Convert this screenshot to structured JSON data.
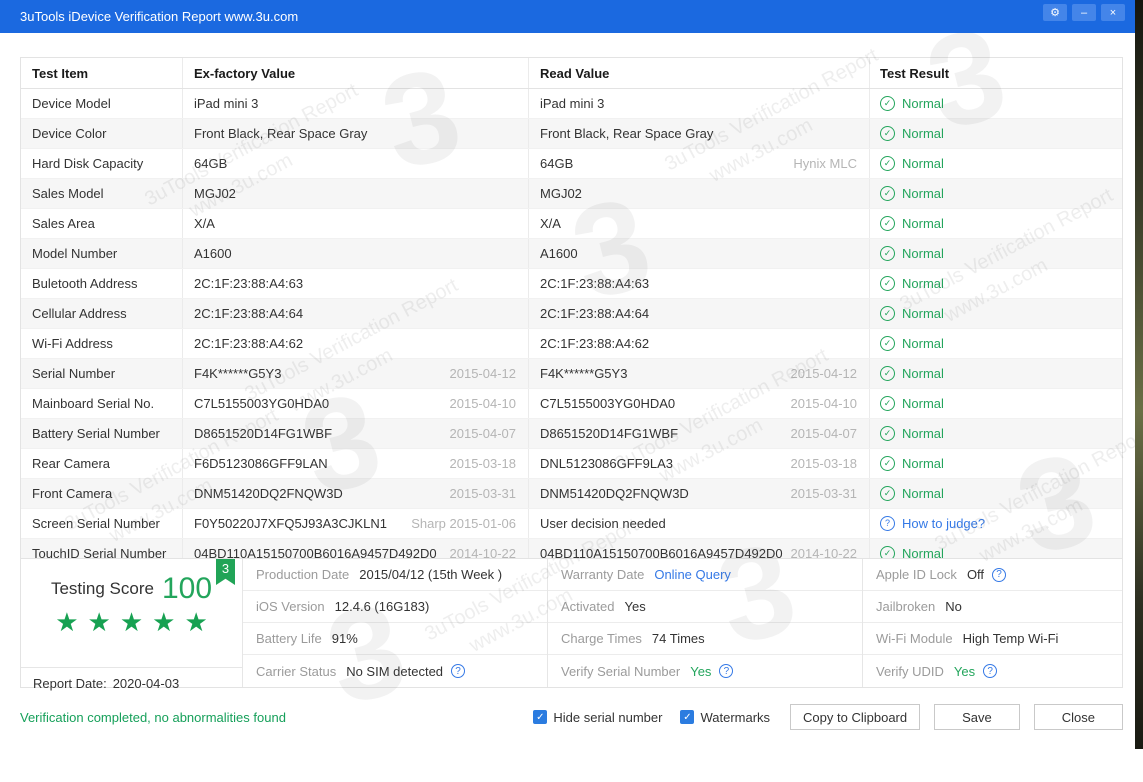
{
  "window": {
    "title": "3uTools iDevice Verification Report www.3u.com",
    "controls": {
      "settings_icon": "⚙",
      "minimize_icon": "–",
      "close_icon": "×"
    }
  },
  "colors": {
    "titlebar_blue": "#1b69e0",
    "accent_green": "#23a55c",
    "link_blue": "#3579e6",
    "checkbox_blue": "#2b7ce0"
  },
  "watermark": {
    "line1": "3uTools Verification Report",
    "line2": "www.3u.com",
    "logo": "3"
  },
  "table": {
    "headers": {
      "item": "Test Item",
      "factory": "Ex-factory Value",
      "read": "Read Value",
      "result": "Test Result"
    },
    "rows": [
      {
        "item": "Device Model",
        "factory": "iPad mini 3",
        "factory_note": "",
        "read": "iPad mini 3",
        "read_note": "",
        "result": "Normal",
        "result_style": "normal",
        "result_icon": "✓",
        "icon_name": "check-circle-icon",
        "result_interactable": "false"
      },
      {
        "item": "Device Color",
        "factory": "Front Black, Rear Space Gray",
        "factory_note": "",
        "read": "Front Black, Rear Space Gray",
        "read_note": "",
        "result": "Normal",
        "result_style": "normal",
        "result_icon": "✓",
        "icon_name": "check-circle-icon",
        "result_interactable": "false"
      },
      {
        "item": "Hard Disk Capacity",
        "factory": "64GB",
        "factory_note": "",
        "read": "64GB",
        "read_note": "Hynix MLC",
        "result": "Normal",
        "result_style": "normal",
        "result_icon": "✓",
        "icon_name": "check-circle-icon",
        "result_interactable": "false"
      },
      {
        "item": "Sales Model",
        "factory": "MGJ02",
        "factory_note": "",
        "read": "MGJ02",
        "read_note": "",
        "result": "Normal",
        "result_style": "normal",
        "result_icon": "✓",
        "icon_name": "check-circle-icon",
        "result_interactable": "false"
      },
      {
        "item": "Sales Area",
        "factory": "X/A",
        "factory_note": "",
        "read": "X/A",
        "read_note": "",
        "result": "Normal",
        "result_style": "normal",
        "result_icon": "✓",
        "icon_name": "check-circle-icon",
        "result_interactable": "false"
      },
      {
        "item": "Model Number",
        "factory": "A1600",
        "factory_note": "",
        "read": "A1600",
        "read_note": "",
        "result": "Normal",
        "result_style": "normal",
        "result_icon": "✓",
        "icon_name": "check-circle-icon",
        "result_interactable": "false"
      },
      {
        "item": "Buletooth Address",
        "factory": "2C:1F:23:88:A4:63",
        "factory_note": "",
        "read": "2C:1F:23:88:A4:63",
        "read_note": "",
        "result": "Normal",
        "result_style": "normal",
        "result_icon": "✓",
        "icon_name": "check-circle-icon",
        "result_interactable": "false"
      },
      {
        "item": "Cellular Address",
        "factory": "2C:1F:23:88:A4:64",
        "factory_note": "",
        "read": "2C:1F:23:88:A4:64",
        "read_note": "",
        "result": "Normal",
        "result_style": "normal",
        "result_icon": "✓",
        "icon_name": "check-circle-icon",
        "result_interactable": "false"
      },
      {
        "item": "Wi-Fi Address",
        "factory": "2C:1F:23:88:A4:62",
        "factory_note": "",
        "read": "2C:1F:23:88:A4:62",
        "read_note": "",
        "result": "Normal",
        "result_style": "normal",
        "result_icon": "✓",
        "icon_name": "check-circle-icon",
        "result_interactable": "false"
      },
      {
        "item": "Serial Number",
        "factory": "F4K******G5Y3",
        "factory_note": "2015-04-12",
        "read": "F4K******G5Y3",
        "read_note": "2015-04-12",
        "result": "Normal",
        "result_style": "normal",
        "result_icon": "✓",
        "icon_name": "check-circle-icon",
        "result_interactable": "false"
      },
      {
        "item": "Mainboard Serial No.",
        "factory": "C7L5155003YG0HDA0",
        "factory_note": "2015-04-10",
        "read": "C7L5155003YG0HDA0",
        "read_note": "2015-04-10",
        "result": "Normal",
        "result_style": "normal",
        "result_icon": "✓",
        "icon_name": "check-circle-icon",
        "result_interactable": "false"
      },
      {
        "item": "Battery Serial Number",
        "factory": "D8651520D14FG1WBF",
        "factory_note": "2015-04-07",
        "read": "D8651520D14FG1WBF",
        "read_note": "2015-04-07",
        "result": "Normal",
        "result_style": "normal",
        "result_icon": "✓",
        "icon_name": "check-circle-icon",
        "result_interactable": "false"
      },
      {
        "item": "Rear Camera",
        "factory": "F6D5123086GFF9LAN",
        "factory_note": "2015-03-18",
        "read": "DNL5123086GFF9LA3",
        "read_note": "2015-03-18",
        "result": "Normal",
        "result_style": "normal",
        "result_icon": "✓",
        "icon_name": "check-circle-icon",
        "result_interactable": "false"
      },
      {
        "item": "Front Camera",
        "factory": "DNM51420DQ2FNQW3D",
        "factory_note": "2015-03-31",
        "read": "DNM51420DQ2FNQW3D",
        "read_note": "2015-03-31",
        "result": "Normal",
        "result_style": "normal",
        "result_icon": "✓",
        "icon_name": "check-circle-icon",
        "result_interactable": "false"
      },
      {
        "item": "Screen Serial Number",
        "factory": "F0Y50220J7XFQ5J93A3CJKLN1",
        "factory_note": "Sharp 2015-01-06",
        "read": "User decision needed",
        "read_note": "",
        "result": "How to judge?",
        "result_style": "question",
        "result_icon": "?",
        "icon_name": "question-circle-icon",
        "result_interactable": "true"
      },
      {
        "item": "TouchID Serial Number",
        "factory": "04BD110A15150700B6016A9457D492D0",
        "factory_note": "2014-10-22",
        "read": "04BD110A15150700B6016A9457D492D0",
        "read_note": "2014-10-22",
        "result": "Normal",
        "result_style": "normal",
        "result_icon": "✓",
        "icon_name": "check-circle-icon",
        "result_interactable": "false"
      }
    ]
  },
  "summary": {
    "score": {
      "label": "Testing Score",
      "value": "100",
      "badge": "3",
      "report_date_label": "Report Date:",
      "report_date": "2020-04-03"
    },
    "stars": [
      "★",
      "★",
      "★",
      "★",
      "★"
    ],
    "help_icon": "?",
    "col1": [
      {
        "label": "Production Date",
        "value": "2015/04/12 (15th Week )",
        "style": "dark",
        "help": false,
        "value_interactable": "false"
      },
      {
        "label": "iOS Version",
        "value": "12.4.6 (16G183)",
        "style": "dark",
        "help": false,
        "value_interactable": "false"
      },
      {
        "label": "Battery Life",
        "value": "91%",
        "style": "dark",
        "help": false,
        "value_interactable": "false"
      },
      {
        "label": "Carrier Status",
        "value": "No SIM detected",
        "style": "dark",
        "help": true,
        "value_interactable": "false"
      }
    ],
    "col2": [
      {
        "label": "Warranty Date",
        "value": "Online Query",
        "style": "link",
        "help": false,
        "value_interactable": "true"
      },
      {
        "label": "Activated",
        "value": "Yes",
        "style": "dark",
        "help": false,
        "value_interactable": "false"
      },
      {
        "label": "Charge Times",
        "value": "74 Times",
        "style": "dark",
        "help": false,
        "value_interactable": "false"
      },
      {
        "label": "Verify Serial Number",
        "value": "Yes",
        "style": "green",
        "help": true,
        "value_interactable": "false"
      }
    ],
    "col3": [
      {
        "label": "Apple ID Lock",
        "value": "Off",
        "style": "dark",
        "help": true,
        "value_interactable": "false"
      },
      {
        "label": "Jailbroken",
        "value": "No",
        "style": "dark",
        "help": false,
        "value_interactable": "false"
      },
      {
        "label": "Wi-Fi Module",
        "value": "High Temp Wi-Fi",
        "style": "dark",
        "help": false,
        "value_interactable": "false"
      },
      {
        "label": "Verify UDID",
        "value": "Yes",
        "style": "green",
        "help": true,
        "value_interactable": "false"
      }
    ]
  },
  "footer": {
    "status": "Verification completed, no abnormalities found",
    "check_icon": "✓",
    "checkboxes": [
      {
        "label": "Hide serial number",
        "checked": true
      },
      {
        "label": "Watermarks",
        "checked": true
      }
    ],
    "buttons": [
      {
        "label": "Copy to Clipboard"
      },
      {
        "label": "Save"
      },
      {
        "label": "Close"
      }
    ]
  }
}
